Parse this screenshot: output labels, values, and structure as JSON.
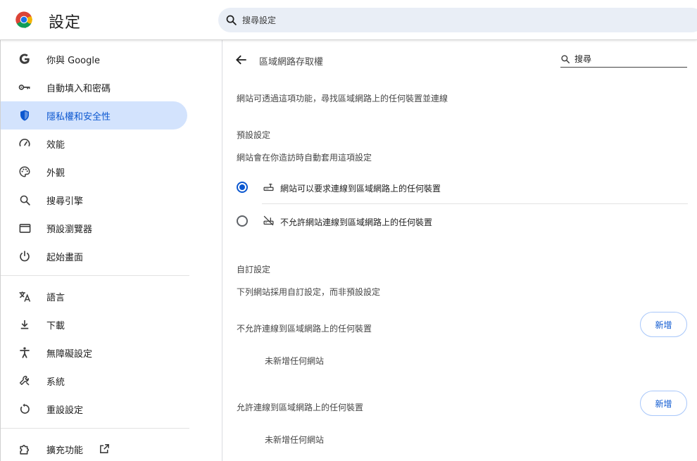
{
  "header": {
    "title": "設定",
    "search_placeholder": "搜尋設定"
  },
  "sidebar": {
    "items": [
      {
        "label": "你與 Google",
        "icon": "google-g-icon"
      },
      {
        "label": "自動填入和密碼",
        "icon": "key-icon"
      },
      {
        "label": "隱私權和安全性",
        "icon": "shield-icon",
        "active": true
      },
      {
        "label": "效能",
        "icon": "speedometer-icon"
      },
      {
        "label": "外觀",
        "icon": "palette-icon"
      },
      {
        "label": "搜尋引擎",
        "icon": "search-icon"
      },
      {
        "label": "預設瀏覽器",
        "icon": "browser-window-icon"
      },
      {
        "label": "起始畫面",
        "icon": "power-icon"
      },
      {
        "label": "語言",
        "icon": "translate-icon"
      },
      {
        "label": "下載",
        "icon": "download-icon"
      },
      {
        "label": "無障礙設定",
        "icon": "accessibility-icon"
      },
      {
        "label": "系統",
        "icon": "wrench-icon"
      },
      {
        "label": "重設設定",
        "icon": "reset-icon"
      },
      {
        "label": "擴充功能",
        "icon": "puzzle-icon",
        "external": "open-in-new-icon"
      }
    ]
  },
  "main": {
    "title": "區域網路存取權",
    "search_placeholder": "搜尋",
    "description": "網站可透過這項功能，尋找區域網路上的任何裝置並連線",
    "default": {
      "heading": "預設設定",
      "subheading": "網站會在你造訪時自動套用這項設定",
      "options": [
        {
          "label": "網站可以要求連線到區域網路上的任何裝置",
          "icon": "router-icon",
          "checked": true
        },
        {
          "label": "不允許網站連線到區域網路上的任何裝置",
          "icon": "router-off-icon",
          "checked": false
        }
      ]
    },
    "custom": {
      "heading": "自訂設定",
      "subheading": "下列網站採用自訂設定，而非預設設定",
      "blocked_label": "不允許連線到區域網路上的任何裝置",
      "allowed_label": "允許連線到區域網路上的任何裝置",
      "add_label": "新增",
      "empty_text": "未新增任何網站"
    }
  },
  "colors": {
    "accent": "#0b57d0",
    "active_bg": "#d3e3fd",
    "search_bg": "#e9eef6"
  }
}
